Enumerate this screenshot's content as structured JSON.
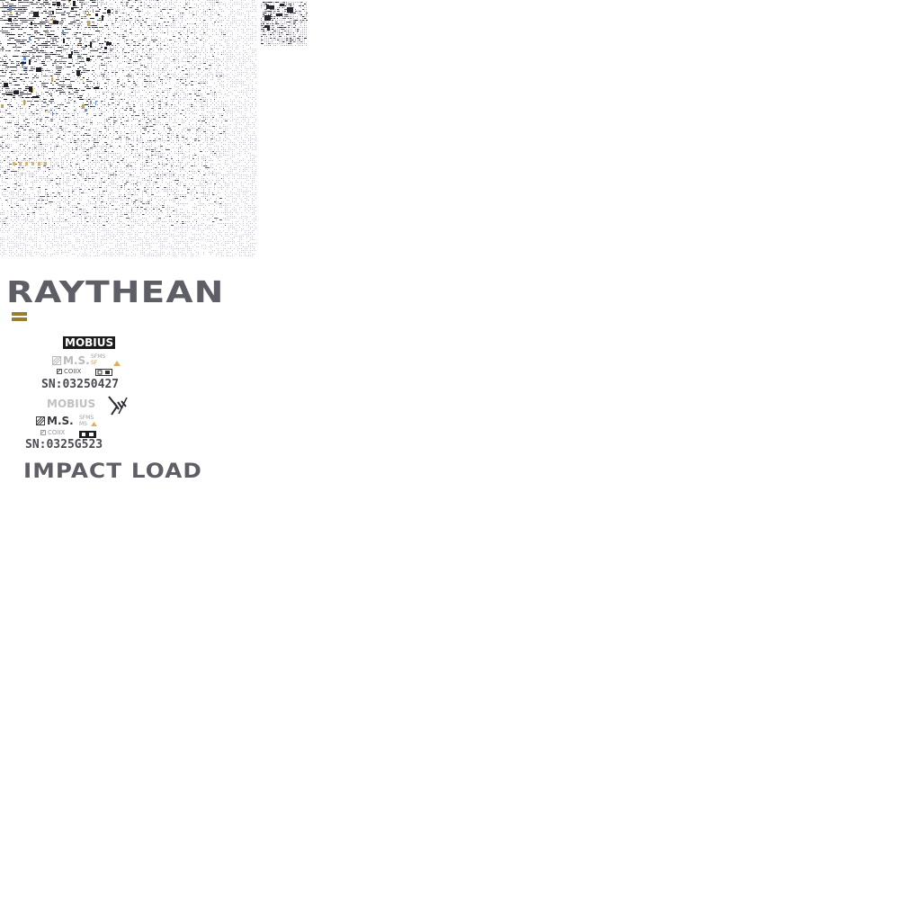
{
  "brand": {
    "name": "RAYTHEAN",
    "color": "#5e5e66",
    "accent_color": "#9a7d2c"
  },
  "decal_set_1": {
    "logo": "MOBIUS",
    "ms_mark": "M.S.",
    "sub_label_1": "SFMS",
    "sub_label_2": "SF",
    "cox_mark": "COIIX",
    "serial": "SN:03250427",
    "warning_icon": "triangle-icon"
  },
  "decal_set_2": {
    "logo": "MOBIUS",
    "ms_mark": "M.S.",
    "sub_label_1": "SFMS",
    "sub_label_2": "MS",
    "cox_mark": "COIIX",
    "serial": "SN:0325G523",
    "emblem_icon": "wing-emblem-icon"
  },
  "footer_label": "IMPACT LOAD",
  "colors": {
    "background": "#ffffff",
    "ink_dark": "#1c1c1c",
    "ink_mid": "#4a4a52",
    "ink_light": "#b9b9be",
    "gold": "#9a7d2c",
    "blue_trace": "#6a8fd0"
  }
}
